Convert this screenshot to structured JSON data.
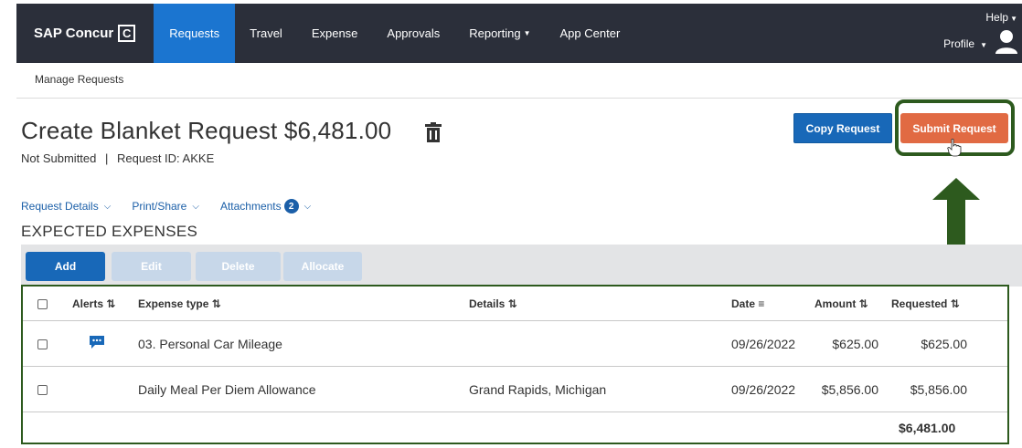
{
  "app": {
    "brand": "SAP Concur",
    "brand_mark": "C"
  },
  "nav": {
    "items": [
      {
        "label": "Requests",
        "active": true
      },
      {
        "label": "Travel",
        "active": false
      },
      {
        "label": "Expense",
        "active": false
      },
      {
        "label": "Approvals",
        "active": false
      },
      {
        "label": "Reporting",
        "active": false,
        "dropdown": true
      },
      {
        "label": "App Center",
        "active": false
      }
    ],
    "help_label": "Help",
    "profile_label": "Profile"
  },
  "breadcrumb": "Manage Requests",
  "page": {
    "title": "Create Blanket Request $6,481.00",
    "status": "Not Submitted",
    "separator": "|",
    "request_id_label": "Request ID: AKKE"
  },
  "actions": {
    "copy_label": "Copy Request",
    "submit_label": "Submit Request"
  },
  "subnav": {
    "request_details": "Request Details",
    "print_share": "Print/Share",
    "attachments": "Attachments",
    "attachments_count": "2"
  },
  "section_title": "EXPECTED EXPENSES",
  "toolbar": {
    "add": "Add",
    "edit": "Edit",
    "delete": "Delete",
    "allocate": "Allocate"
  },
  "table": {
    "headers": {
      "alerts": "Alerts",
      "expense_type": "Expense type",
      "details": "Details",
      "date": "Date",
      "amount": "Amount",
      "requested": "Requested"
    },
    "rows": [
      {
        "expense_type": "03. Personal Car Mileage",
        "details": "",
        "date": "09/26/2022",
        "amount": "$625.00",
        "requested": "$625.00",
        "alert": true
      },
      {
        "expense_type": "Daily Meal Per Diem Allowance",
        "details": "Grand Rapids, Michigan",
        "date": "09/26/2022",
        "amount": "$5,856.00",
        "requested": "$5,856.00",
        "alert": false
      }
    ],
    "total": "$6,481.00"
  },
  "colors": {
    "nav_bg": "#2b2f3a",
    "nav_active": "#1b75d0",
    "primary": "#1868b8",
    "submit": "#e16a43",
    "highlight": "#2d5a1e"
  }
}
